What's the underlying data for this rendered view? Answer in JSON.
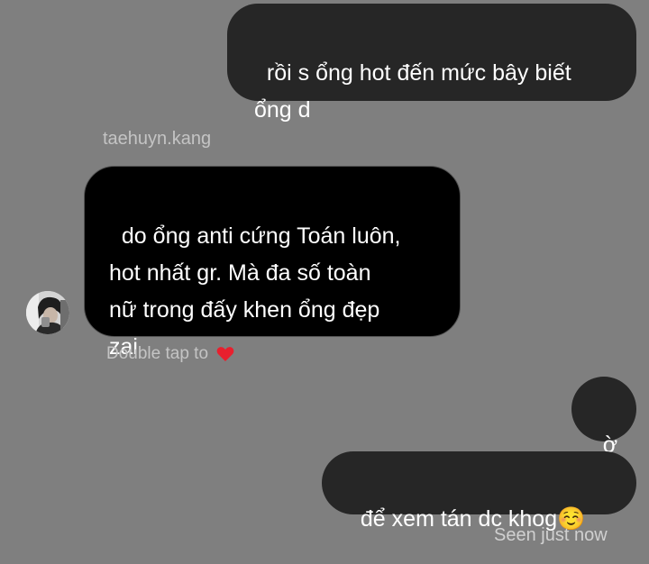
{
  "thread": {
    "messages": [
      {
        "from": "me",
        "text": "rồi s ổng hot đến mức bây biết\nổng d"
      },
      {
        "from": "taehuyn.kang",
        "sender_label": "taehuyn.kang",
        "text": "do ổng anti cứng Toán luôn,\nhot nhất gr. Mà đa số toàn\nnữ trong đấy khen ổng đẹp\nzai",
        "hint": "Double tap to",
        "hint_icon": "heart-icon"
      },
      {
        "from": "me",
        "text": "ờ"
      },
      {
        "from": "me",
        "text": "để xem tán dc khog☺️",
        "status": "Seen just now"
      }
    ]
  },
  "colors": {
    "background": "#7f7f7f",
    "sent_bubble": "#262626",
    "received_bubble": "#000000",
    "heart": "#e8202e"
  }
}
